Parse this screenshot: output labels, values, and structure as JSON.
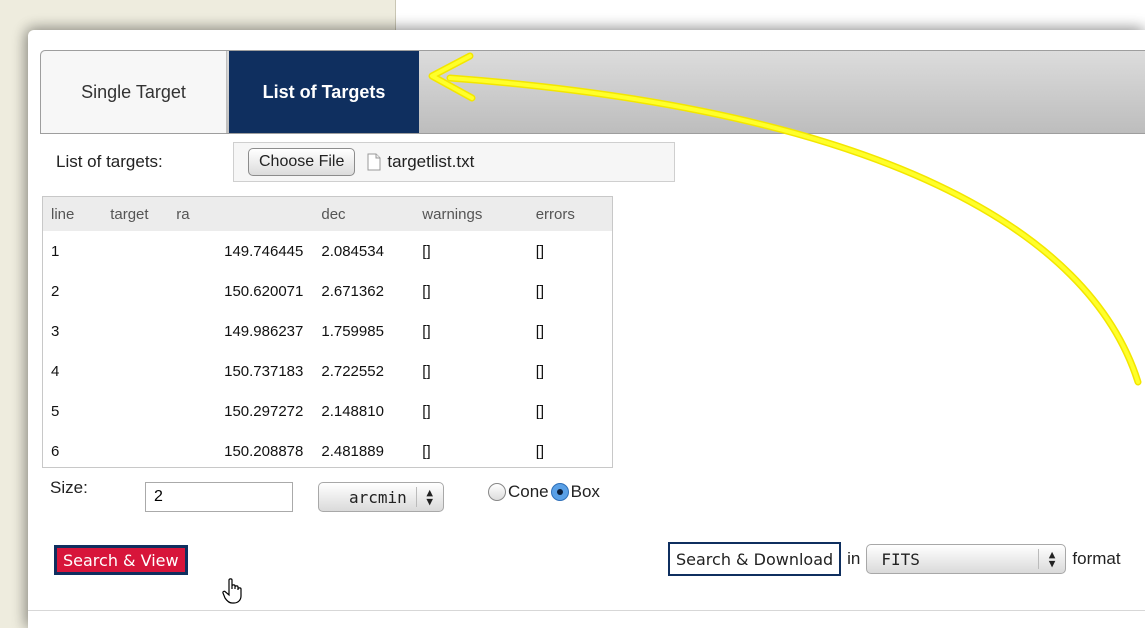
{
  "tabs": {
    "single": "Single Target",
    "list": "List of Targets"
  },
  "file_row": {
    "label": "List of targets:",
    "choose_button": "Choose File",
    "file_name": "targetlist.txt"
  },
  "table": {
    "headers": [
      "line",
      "target",
      "ra",
      "dec",
      "warnings",
      "errors"
    ],
    "rows": [
      {
        "line": "1",
        "target": "",
        "ra": "149.746445",
        "dec": "2.084534",
        "warnings": "[]",
        "errors": "[]"
      },
      {
        "line": "2",
        "target": "",
        "ra": "150.620071",
        "dec": "2.671362",
        "warnings": "[]",
        "errors": "[]"
      },
      {
        "line": "3",
        "target": "",
        "ra": "149.986237",
        "dec": "1.759985",
        "warnings": "[]",
        "errors": "[]"
      },
      {
        "line": "4",
        "target": "",
        "ra": "150.737183",
        "dec": "2.722552",
        "warnings": "[]",
        "errors": "[]"
      },
      {
        "line": "5",
        "target": "",
        "ra": "150.297272",
        "dec": "2.148810",
        "warnings": "[]",
        "errors": "[]"
      },
      {
        "line": "6",
        "target": "",
        "ra": "150.208878",
        "dec": "2.481889",
        "warnings": "[]",
        "errors": "[]"
      }
    ]
  },
  "size": {
    "label": "Size:",
    "value": "2",
    "unit": "arcmin",
    "shape_options": [
      "Cone",
      "Box"
    ],
    "shape_selected": "Box"
  },
  "actions": {
    "search_view": "Search & View",
    "search_download": "Search & Download",
    "in_label": "in",
    "format_value": "FITS",
    "format_label": "format"
  },
  "colors": {
    "active_tab": "#0f2f5f",
    "search_view_bg": "#d7153a",
    "annotation_arrow": "#ffff00"
  }
}
